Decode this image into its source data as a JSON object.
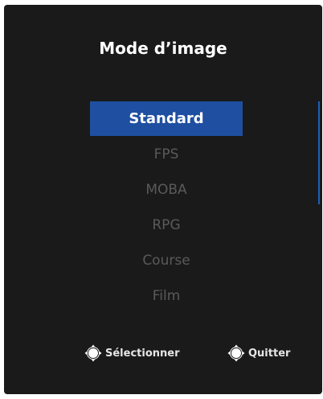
{
  "osd": {
    "title": "Mode d’image",
    "items": [
      {
        "label": "Standard",
        "selected": true
      },
      {
        "label": "FPS",
        "selected": false
      },
      {
        "label": "MOBA",
        "selected": false
      },
      {
        "label": "RPG",
        "selected": false
      },
      {
        "label": "Course",
        "selected": false
      },
      {
        "label": "Film",
        "selected": false
      }
    ],
    "footer": {
      "select_label": "Sélectionner",
      "select_icon": "joystick-select-icon",
      "quit_label": "Quitter",
      "quit_icon": "joystick-back-icon"
    },
    "colors": {
      "background": "#1a1a1a",
      "highlight": "#1f4fa1",
      "text_selected": "#ffffff",
      "text_dim": "#5a5a5a"
    }
  }
}
